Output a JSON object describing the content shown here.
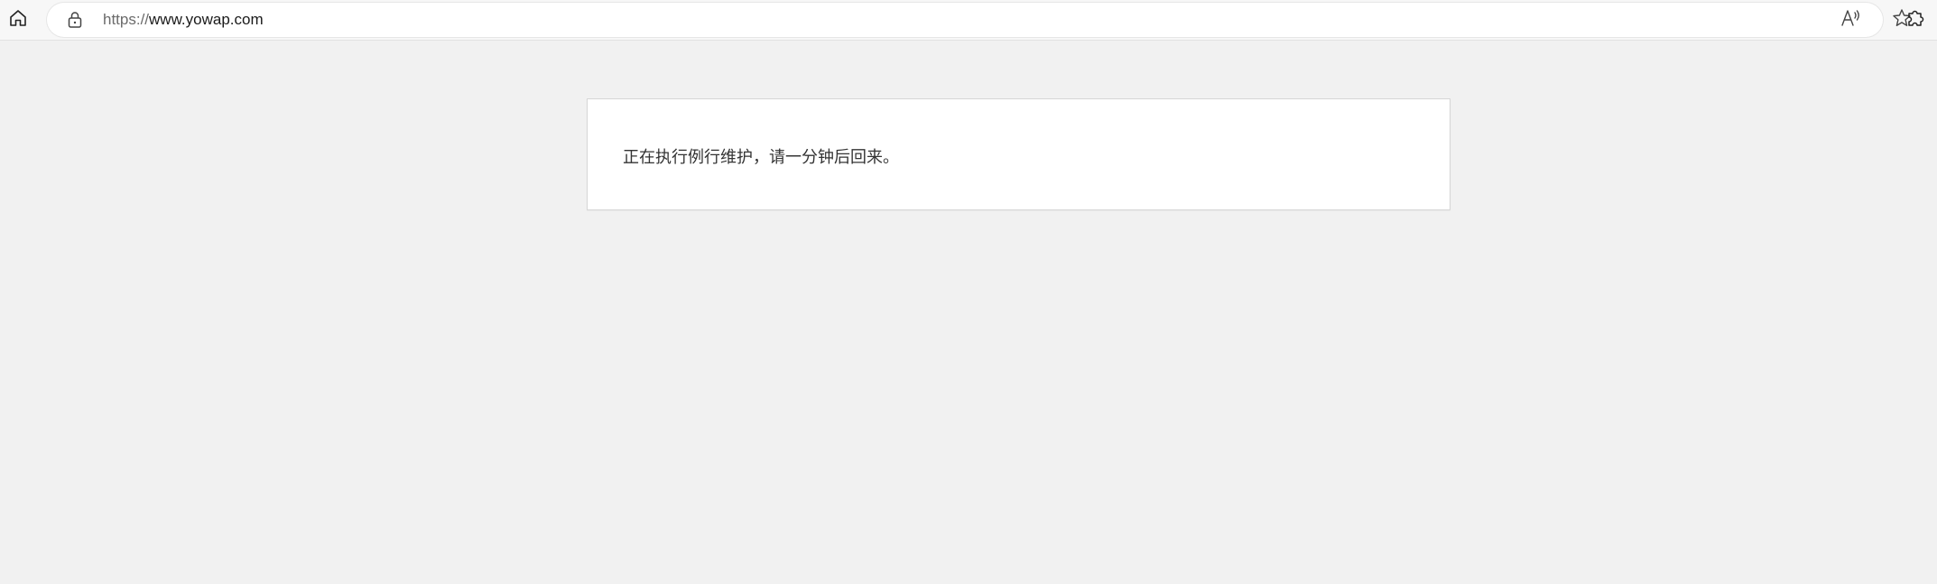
{
  "browser": {
    "url_scheme": "https://",
    "url_host": "www.yowap.com",
    "icons": {
      "home": "home-icon",
      "lock": "lock-icon",
      "read_aloud": "read-aloud-icon",
      "favorite": "star-icon",
      "extensions": "puzzle-icon"
    }
  },
  "page": {
    "maintenance_message": "正在执行例行维护，请一分钟后回来。"
  },
  "colors": {
    "page_background": "#f1f1f1",
    "card_background": "#ffffff",
    "card_border": "#d6d6d6",
    "text": "#333333"
  }
}
